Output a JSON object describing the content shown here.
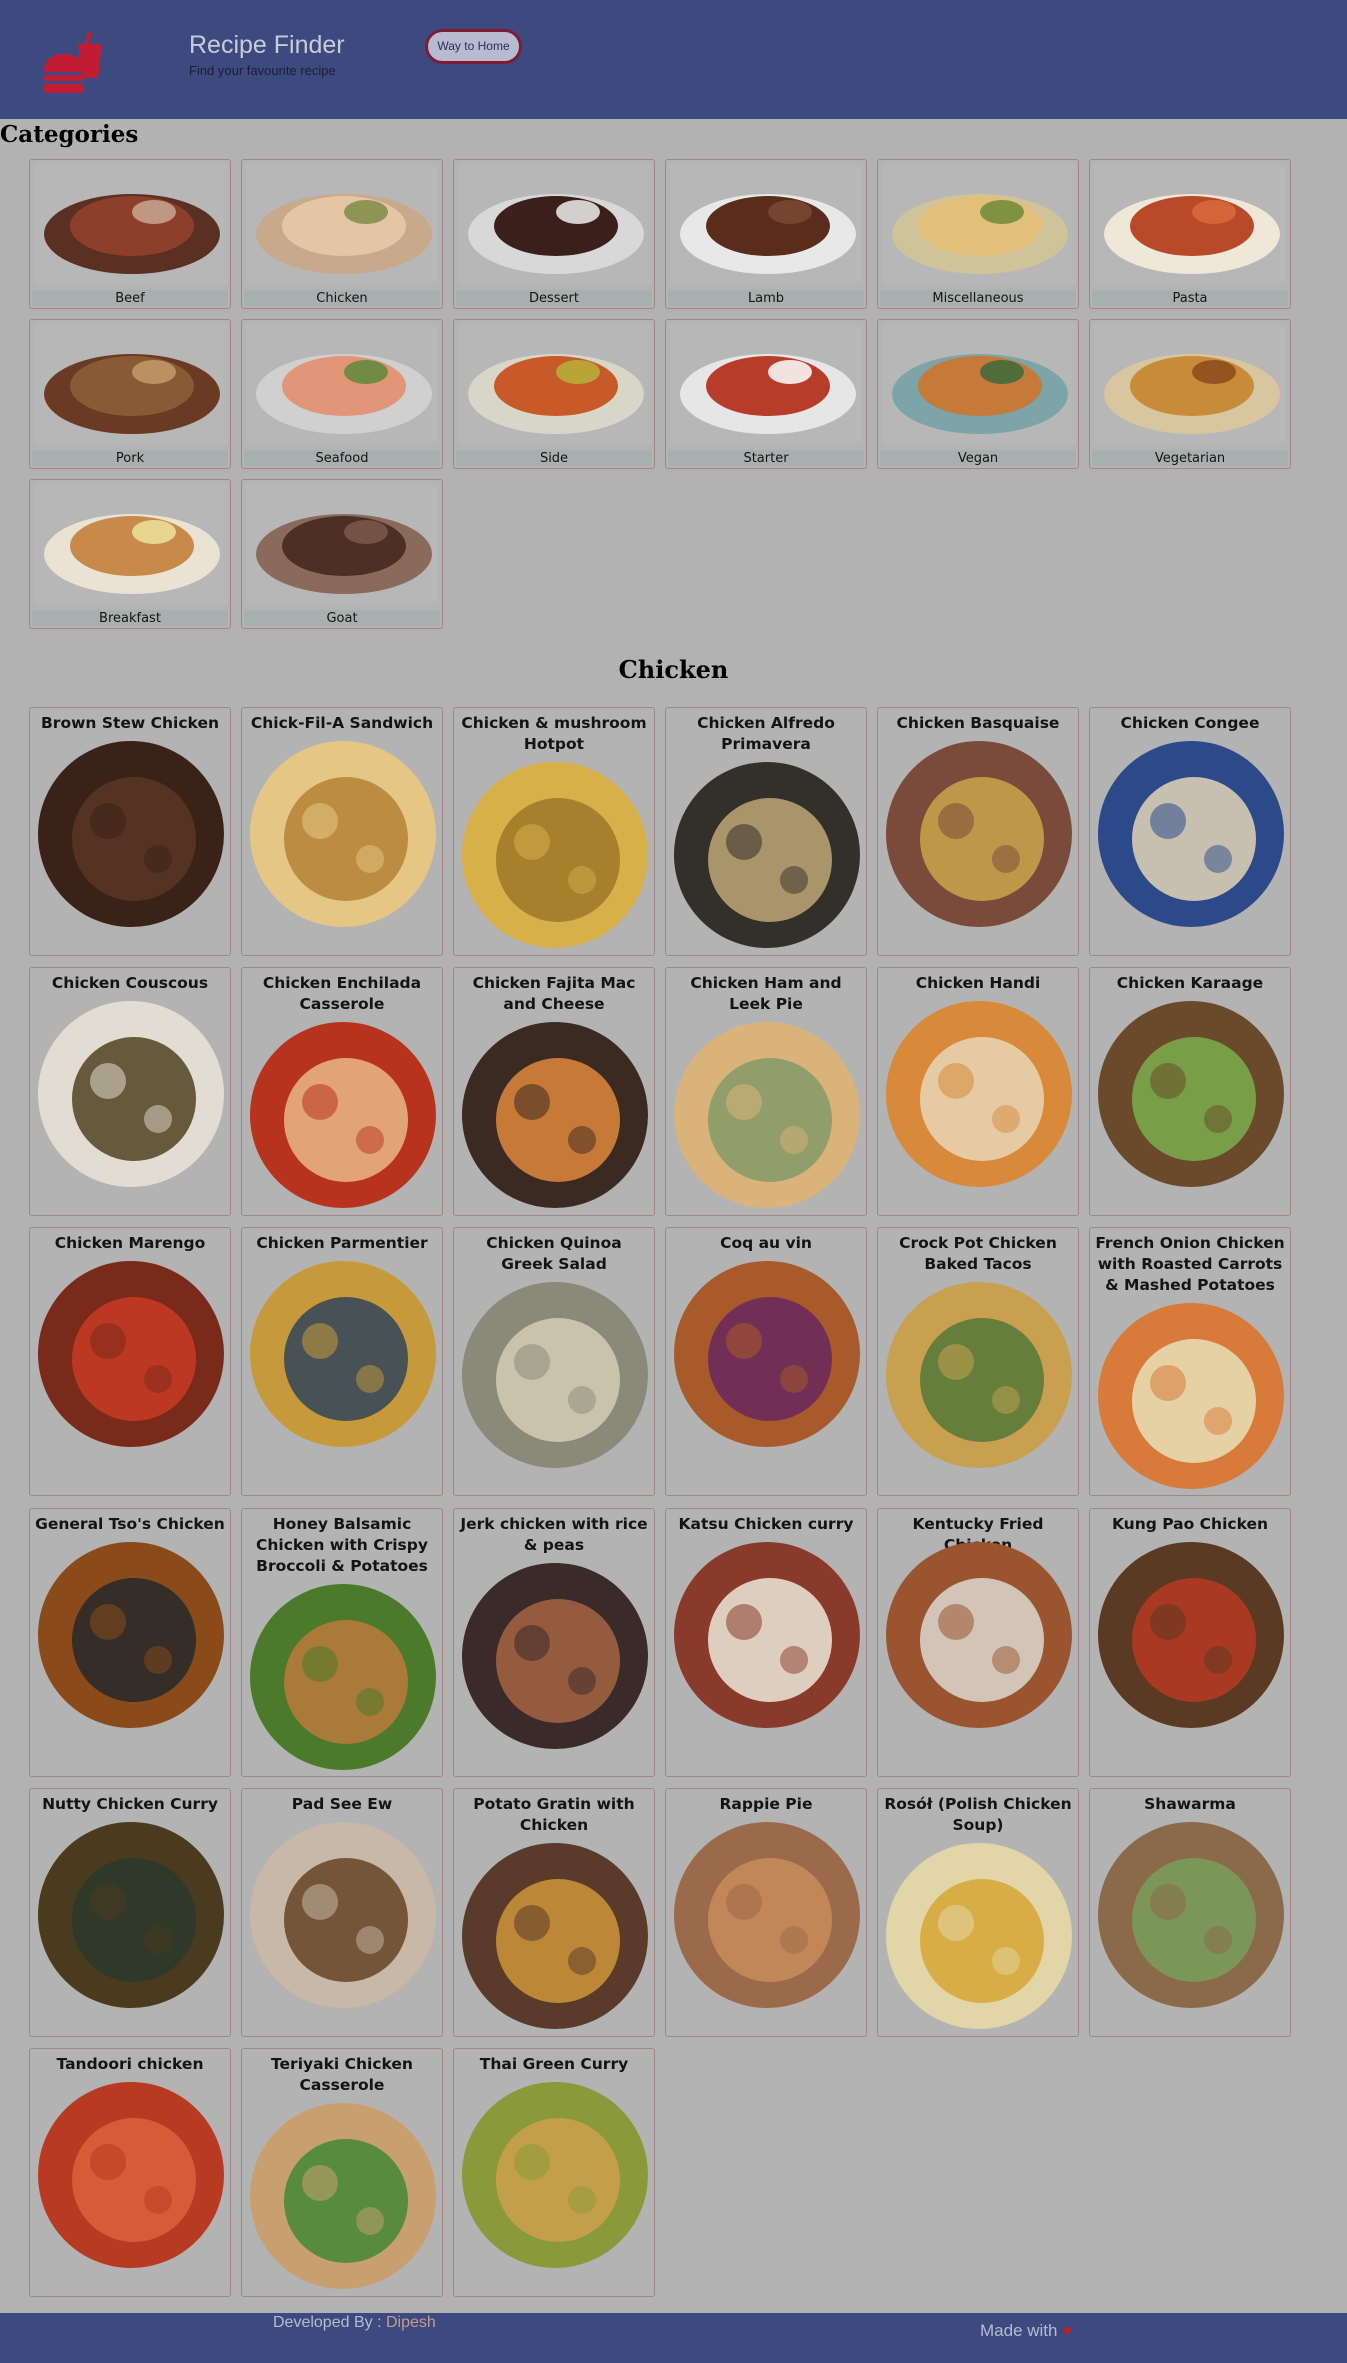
{
  "header": {
    "title": "Recipe Finder",
    "subtitle": "Find your favourite recipe",
    "home_button": "Way to Home",
    "logo_icon": "burger-drink-logo-icon"
  },
  "categories": {
    "heading": "Categories",
    "items": [
      {
        "label": "Beef"
      },
      {
        "label": "Chicken"
      },
      {
        "label": "Dessert"
      },
      {
        "label": "Lamb"
      },
      {
        "label": "Miscellaneous"
      },
      {
        "label": "Pasta"
      },
      {
        "label": "Pork"
      },
      {
        "label": "Seafood"
      },
      {
        "label": "Side"
      },
      {
        "label": "Starter"
      },
      {
        "label": "Vegan"
      },
      {
        "label": "Vegetarian"
      },
      {
        "label": "Breakfast"
      },
      {
        "label": "Goat"
      }
    ]
  },
  "meals": {
    "heading": "Chicken",
    "items": [
      {
        "name": "Brown Stew Chicken"
      },
      {
        "name": "Chick-Fil-A Sandwich"
      },
      {
        "name": "Chicken & mushroom Hotpot"
      },
      {
        "name": "Chicken Alfredo Primavera"
      },
      {
        "name": "Chicken Basquaise"
      },
      {
        "name": "Chicken Congee"
      },
      {
        "name": "Chicken Couscous"
      },
      {
        "name": "Chicken Enchilada Casserole"
      },
      {
        "name": "Chicken Fajita Mac and Cheese"
      },
      {
        "name": "Chicken Ham and Leek Pie"
      },
      {
        "name": "Chicken Handi"
      },
      {
        "name": "Chicken Karaage"
      },
      {
        "name": "Chicken Marengo"
      },
      {
        "name": "Chicken Parmentier"
      },
      {
        "name": "Chicken Quinoa Greek Salad"
      },
      {
        "name": "Coq au vin"
      },
      {
        "name": "Crock Pot Chicken Baked Tacos"
      },
      {
        "name": "French Onion Chicken with Roasted Carrots & Mashed Potatoes"
      },
      {
        "name": "General Tso's Chicken"
      },
      {
        "name": "Honey Balsamic Chicken with Crispy Broccoli & Potatoes"
      },
      {
        "name": "Jerk chicken with rice & peas"
      },
      {
        "name": "Katsu Chicken curry"
      },
      {
        "name": "Kentucky Fried Chicken"
      },
      {
        "name": "Kung Pao Chicken"
      },
      {
        "name": "Nutty Chicken Curry"
      },
      {
        "name": "Pad See Ew"
      },
      {
        "name": "Potato Gratin with Chicken"
      },
      {
        "name": "Rappie Pie"
      },
      {
        "name": "Rosół (Polish Chicken Soup)"
      },
      {
        "name": "Shawarma"
      },
      {
        "name": "Tandoori chicken"
      },
      {
        "name": "Teriyaki Chicken Casserole"
      },
      {
        "name": "Thai Green Curry"
      }
    ]
  },
  "footer": {
    "developed_by": "Developed By : ",
    "developer": "Dipesh",
    "made_with": "Made with",
    "heart_icon": "heart-icon"
  },
  "colors": {
    "header_bg": "#3d4a80",
    "page_bg": "#b2b2b2",
    "card_border": "#a48484",
    "button_border": "#7a1d35"
  }
}
